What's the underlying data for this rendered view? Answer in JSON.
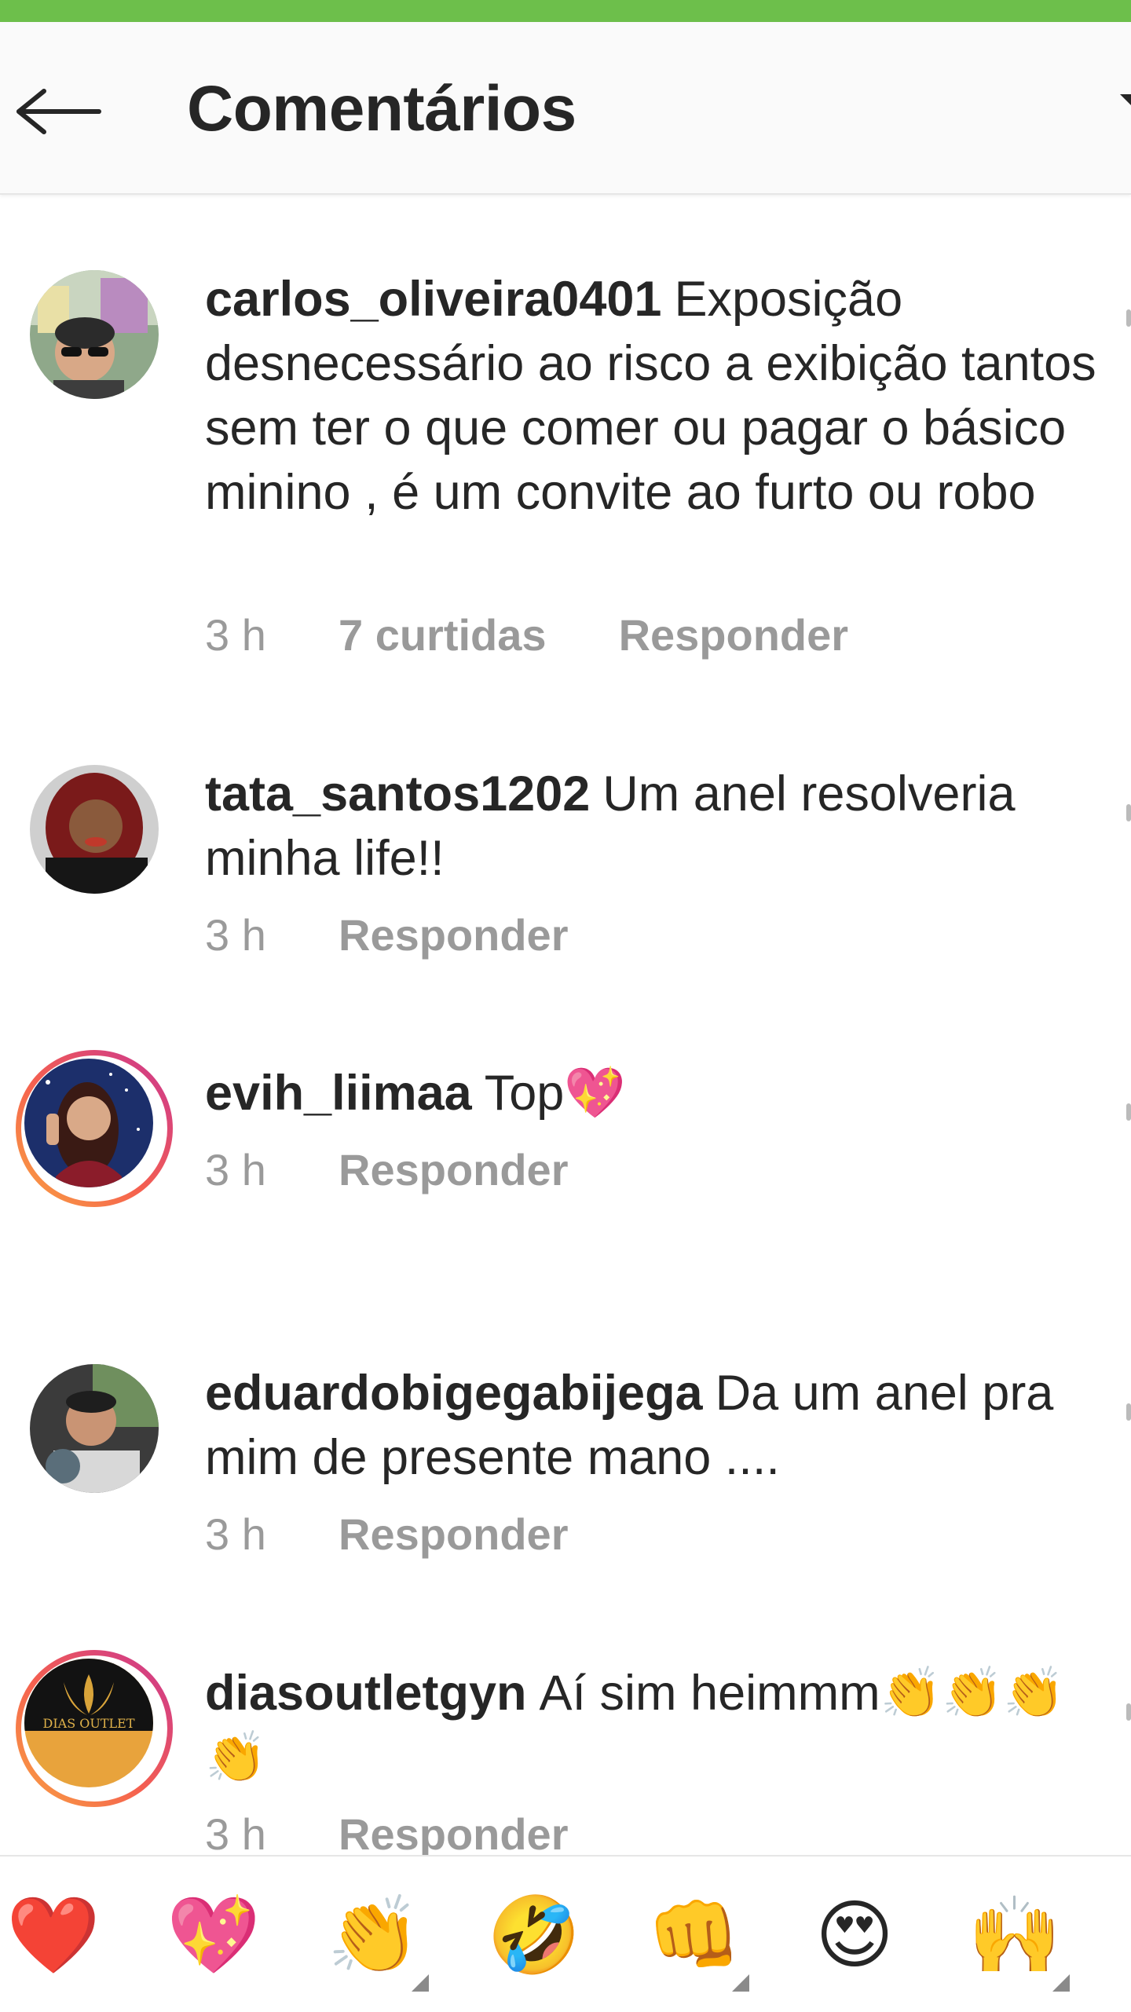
{
  "header": {
    "title": "Comentários"
  },
  "comments": [
    {
      "username": "carlos_oliveira0401",
      "text": "Exposição desnecessário ao risco a exibição tantos sem ter o que comer ou pagar o básico minino , é um convite ao furto ou robo",
      "time": "3 h",
      "likes": "7 curtidas",
      "reply": "Responder"
    },
    {
      "username": "tata_santos1202",
      "text": "Um anel resolveria minha life!!",
      "time": "3 h",
      "reply": "Responder"
    },
    {
      "username": "evih_liimaa",
      "text": "Top💖",
      "time": "3 h",
      "reply": "Responder"
    },
    {
      "username": "eduardobigegabijega",
      "text": "Da um anel pra mim de presente mano ....",
      "time": "3 h",
      "reply": "Responder"
    },
    {
      "username": "diasoutletgyn",
      "text": "Aí sim heimmm👏👏👏👏",
      "time": "3 h",
      "reply": "Responder"
    }
  ],
  "avatars": {
    "diasoutlet_logo_text": "DIAS OUTLET"
  },
  "reactions": [
    "❤️",
    "💖",
    "👏",
    "🤣",
    "👊",
    "😍",
    "🙌"
  ],
  "colors": {
    "status_bar": "#6dbf4b",
    "story_ring_start": "#f9a441",
    "story_ring_end": "#c93493"
  }
}
